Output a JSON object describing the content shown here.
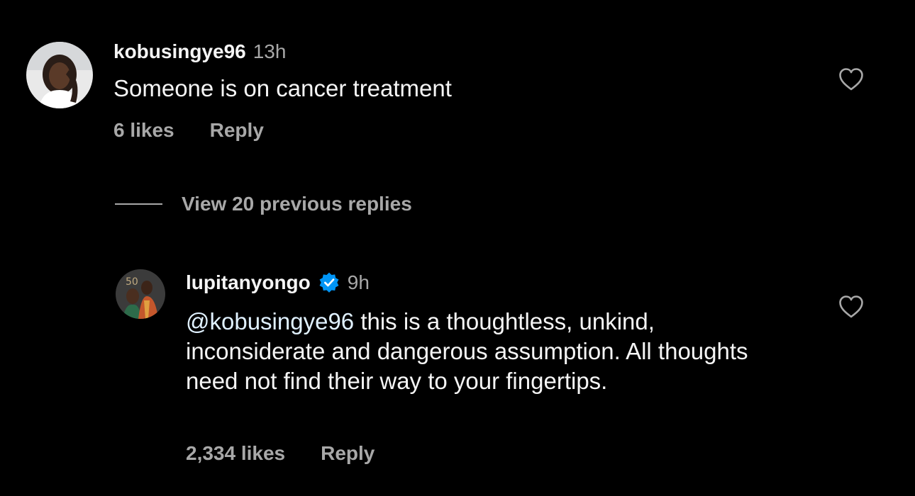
{
  "comment": {
    "username": "kobusingye96",
    "time": "13h",
    "text": "Someone is on cancer treatment",
    "likes": "6 likes",
    "reply_label": "Reply"
  },
  "view_replies": {
    "label": "View 20 previous replies"
  },
  "reply": {
    "username": "lupitanyongo",
    "verified": true,
    "time": "9h",
    "mention": "@kobusingye96",
    "text": " this is a thoughtless, unkind, inconsiderate and dangerous assumption. All thoughts need not find their way to your fingertips.",
    "likes": "2,334 likes",
    "reply_label": "Reply"
  },
  "icons": {
    "heart": "heart-outline-icon",
    "verified": "verified-badge-icon"
  },
  "colors": {
    "background": "#000000",
    "primary_text": "#f5f5f5",
    "secondary_text": "#a8a8a8",
    "mention": "#e0f1ff",
    "verified_badge": "#0095f6"
  }
}
